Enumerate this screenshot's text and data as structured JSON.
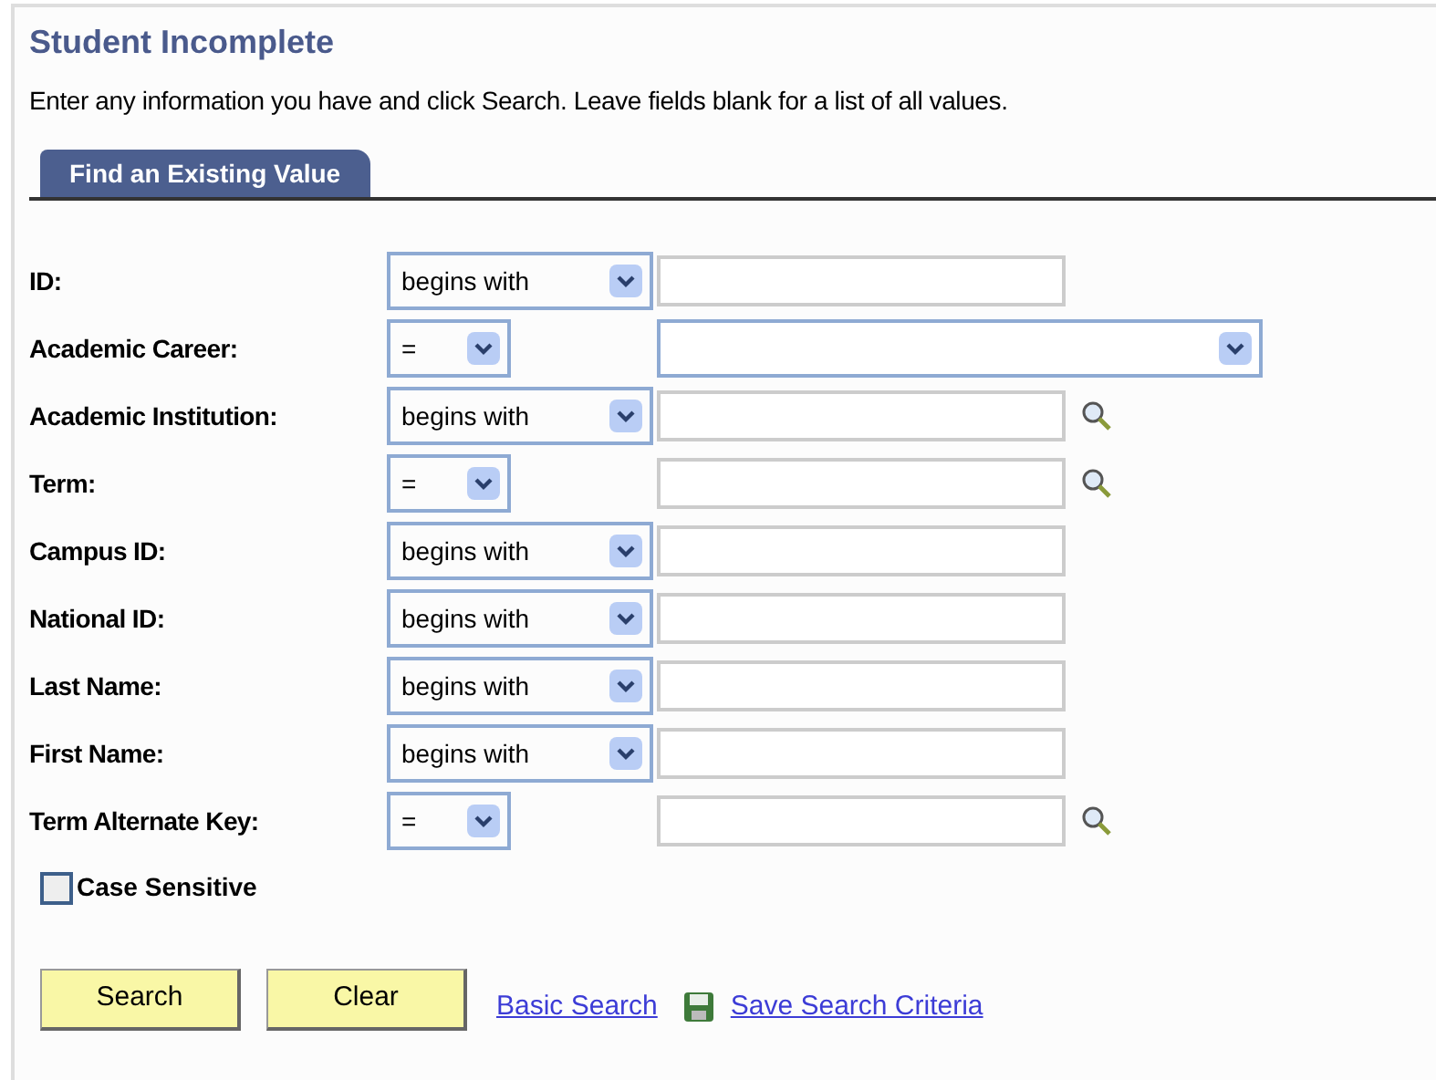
{
  "page": {
    "title": "Student Incomplete",
    "instructions": "Enter any information you have and click Search. Leave fields blank for a list of all values."
  },
  "tabs": [
    {
      "label": "Find an Existing Value",
      "selected": true
    }
  ],
  "fields": [
    {
      "label": "ID:",
      "operator": "begins with",
      "kind": "text"
    },
    {
      "label": "Academic Career:",
      "operator": "=",
      "kind": "dropdown"
    },
    {
      "label": "Academic Institution:",
      "operator": "begins with",
      "kind": "lookup"
    },
    {
      "label": "Term:",
      "operator": "=",
      "kind": "lookup"
    },
    {
      "label": "Campus ID:",
      "operator": "begins with",
      "kind": "text"
    },
    {
      "label": "National ID:",
      "operator": "begins with",
      "kind": "text"
    },
    {
      "label": "Last Name:",
      "operator": "begins with",
      "kind": "text"
    },
    {
      "label": "First Name:",
      "operator": "begins with",
      "kind": "text"
    },
    {
      "label": "Term Alternate Key:",
      "operator": "=",
      "kind": "lookup"
    }
  ],
  "case_sensitive": {
    "label": "Case Sensitive",
    "checked": false
  },
  "buttons": [
    "Search",
    "Clear"
  ],
  "links": [
    {
      "label": "Basic Search",
      "kind": "plain"
    },
    {
      "label": "Save Search Criteria",
      "kind": "save"
    }
  ]
}
